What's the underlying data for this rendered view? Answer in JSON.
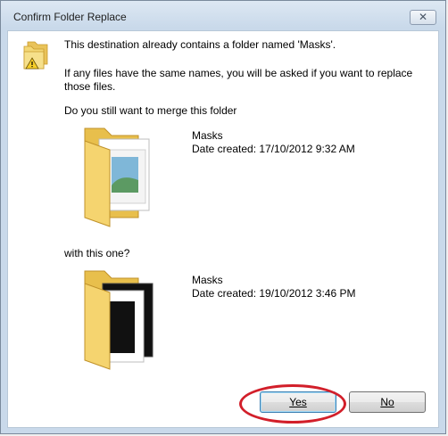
{
  "window": {
    "title": "Confirm Folder Replace",
    "close_label": "✕"
  },
  "message": {
    "line1": "This destination already contains a folder named 'Masks'.",
    "line2": "If any files have the same names, you will be asked if you want to replace those files.",
    "line3": "Do you still want to merge this folder",
    "line4": "with this one?"
  },
  "source_folder": {
    "name": "Masks",
    "date_created": "Date created: 17/10/2012 9:32 AM"
  },
  "target_folder": {
    "name": "Masks",
    "date_created": "Date created: 19/10/2012 3:46 PM"
  },
  "buttons": {
    "yes_label": "Yes",
    "no_label": "No"
  },
  "colors": {
    "highlight": "#d21f2a",
    "folder_yellow": "#f2cf5e",
    "accent_blue": "#3c7fb1"
  }
}
